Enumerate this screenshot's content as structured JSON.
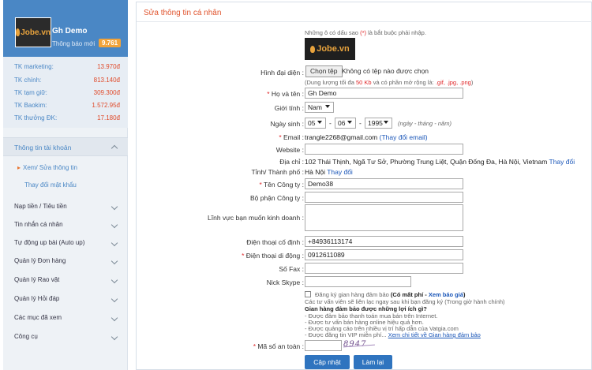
{
  "sidebar": {
    "avatar_brand": "Jobe.vn",
    "user_name": "Gh Demo",
    "notify_label": "Thông báo mới",
    "notify_count": "9.761",
    "accounts": [
      {
        "label": "TK marketing:",
        "value": "13.970đ"
      },
      {
        "label": "TK chính:",
        "value": "813.140đ"
      },
      {
        "label": "TK tạm giữ:",
        "value": "309.300đ"
      },
      {
        "label": "TK Baokim:",
        "value": "1.572.95đ"
      },
      {
        "label": "TK thưởng ĐK:",
        "value": "17.180đ"
      }
    ],
    "menu_head": "Thông tin tài khoản",
    "sub_items": [
      {
        "label": "Xem/ Sửa thông tin"
      },
      {
        "label": "Thay đổi mật khẩu"
      }
    ],
    "nav": [
      {
        "label": "Nạp tiền / Tiêu tiền"
      },
      {
        "label": "Tin nhắn cá nhân"
      },
      {
        "label": "Tự động up bài (Auto up)"
      },
      {
        "label": "Quản lý Đơn hàng"
      },
      {
        "label": "Quản lý Rao vặt"
      },
      {
        "label": "Quản lý Hỏi đáp"
      },
      {
        "label": "Các mục đã xem"
      },
      {
        "label": "Công cụ"
      }
    ]
  },
  "form": {
    "title": "Sửa thông tin cá nhân",
    "required_note_pre": "Những ô có dấu sao",
    "required_note_star": "(*)",
    "required_note_post": "là bắt buộc phải nhập.",
    "logo_brand": "Jobe.vn",
    "avatar_label": "Hình đại diện :",
    "file_button": "Chọn tệp",
    "file_status": "Không có tệp nào được chọn",
    "file_hint_pre": "(Dung lượng tối đa",
    "file_hint_size": "50 Kb",
    "file_hint_mid": "và có phần mở rộng là:",
    "file_hint_ext": ".gif, .jpg, .png",
    "file_hint_end": ")",
    "name_label": "Họ và tên :",
    "name_value": "Gh Demo",
    "gender_label": "Giới tính :",
    "gender_value": "Nam",
    "dob_label": "Ngày sinh :",
    "dob_day": "05",
    "dob_month": "06",
    "dob_year": "1995",
    "dob_sep": "-",
    "dob_hint": "(ngày - tháng - năm)",
    "email_label": "Email :",
    "email_value": "trangle2268@gmail.com",
    "email_change": "(Thay đổi email)",
    "website_label": "Website :",
    "address_label": "Địa chỉ :",
    "address_value": "102 Thái Thịnh, Ngã Tư Sở, Phường Trung Liệt, Quận Đống Đa, Hà Nội, Vietnam",
    "address_change": "Thay đổi",
    "city_label": "Tỉnh/ Thành phố :",
    "city_value": "Hà Nội",
    "city_change": "Thay đổi",
    "company_label": "Tên Công ty :",
    "company_value": "Demo38",
    "dept_label": "Bộ phận Công ty :",
    "field_label": "Lĩnh vực bạn muốn kinh doanh :",
    "phone_label": "Điện thoại cố định :",
    "phone_value": "+84936113174",
    "mobile_label": "Điện thoại di động :",
    "mobile_value": "0912611089",
    "fax_label": "Số Fax :",
    "skype_label": "Nick Skype :",
    "guarantee_check": "Đăng ký gian hàng đảm bảo",
    "guarantee_paid": "(Có mất phí -",
    "guarantee_link": "Xem báo giá",
    "guarantee_close": ")",
    "guarantee_note": "Các tư vấn viên sẽ liên lạc ngay sau khi bạn đăng ký (Trong giờ hành chính)",
    "benefit_title": "Gian hàng đảm bảo được những lợi ích gì?",
    "benefits": [
      "- Được đảm bảo thanh toán mua bán trên Internet.",
      "- Được tư vấn bán hàng online hiệu quả hơn.",
      "- Được quảng cáo trên nhiều vị trí hấp dẫn của Vatgia.com",
      "- Được đăng tin VIP miễn phí..."
    ],
    "benefit_link": "Xem chi tiết về Gian hàng đảm bảo",
    "captcha_label": "Mã số an toàn :",
    "captcha_text": "8947",
    "update_button": "Cập nhật",
    "reset_button": "Làm lại"
  }
}
